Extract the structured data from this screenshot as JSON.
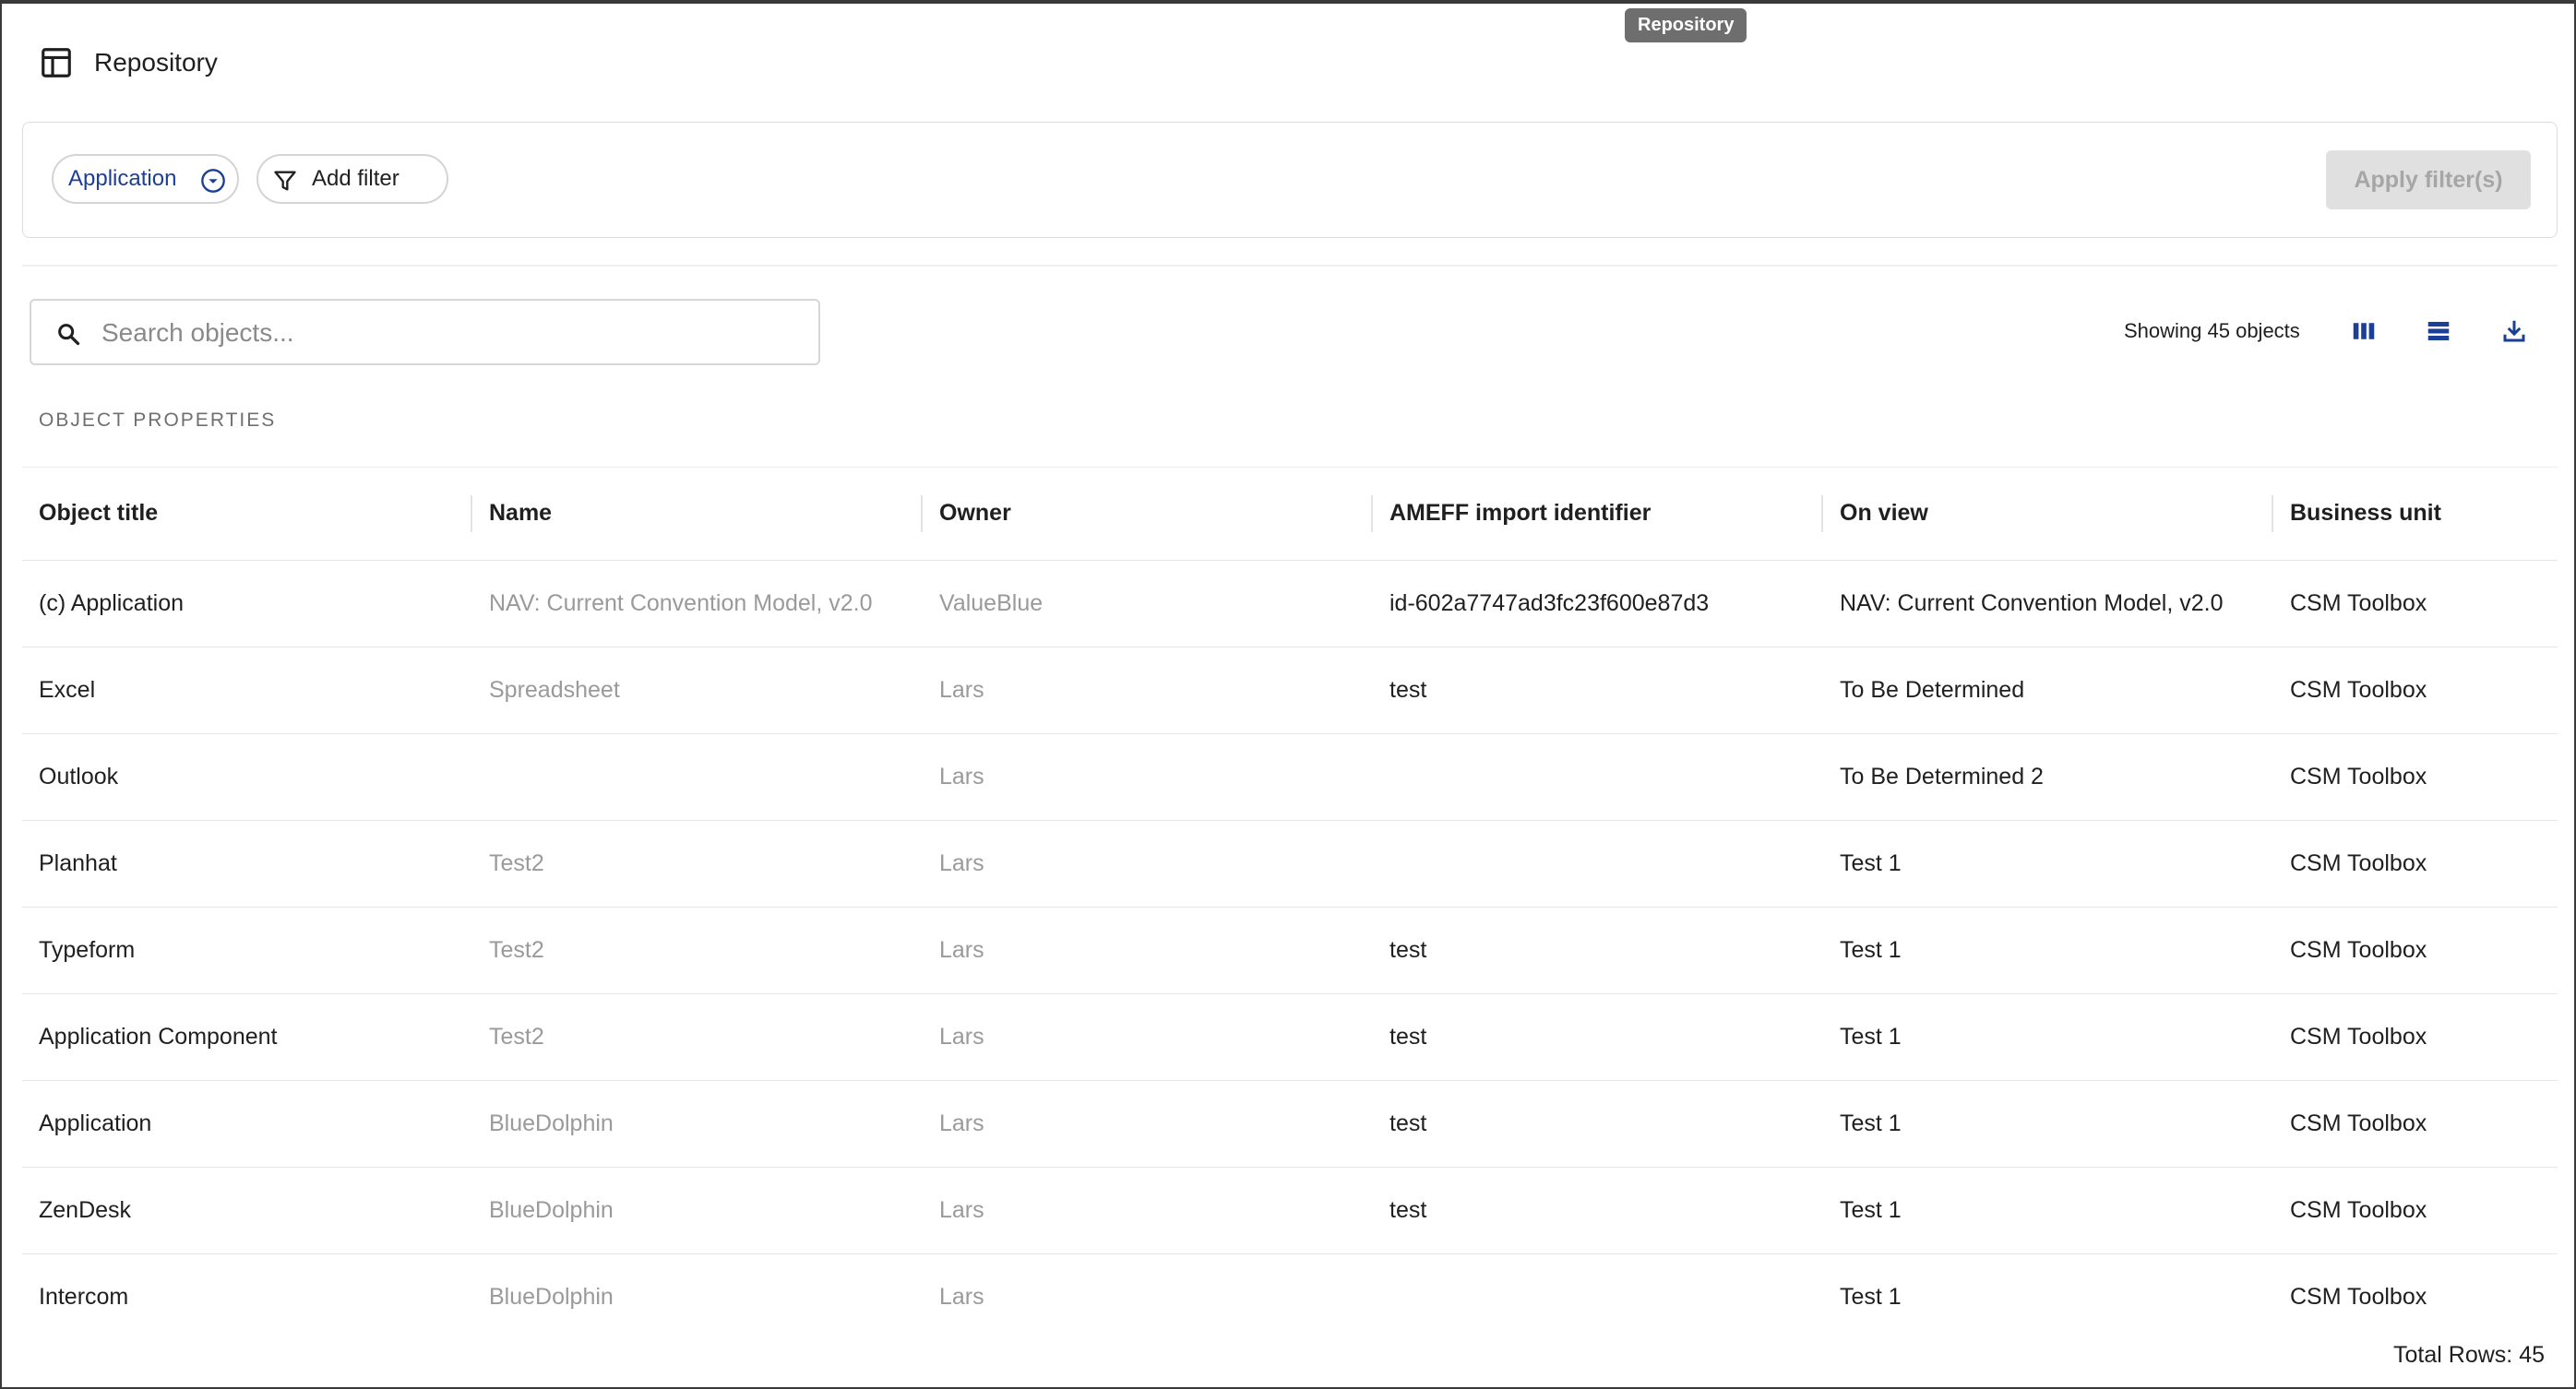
{
  "tooltip": "Repository",
  "header": {
    "title": "Repository",
    "icon": "table-icon"
  },
  "filters": {
    "chip_label": "Application",
    "add_filter_label": "Add filter",
    "apply_label": "Apply filter(s)"
  },
  "search": {
    "placeholder": "Search objects...",
    "value": ""
  },
  "toolbar": {
    "showing_text": "Showing 45 objects"
  },
  "section_label": "OBJECT PROPERTIES",
  "table": {
    "columns": [
      "Object title",
      "Name",
      "Owner",
      "AMEFF import identifier",
      "On view",
      "Business unit"
    ],
    "rows": [
      [
        "(c) Application",
        "NAV: Current Convention Model, v2.0",
        "ValueBlue",
        "id-602a7747ad3fc23f600e87d3",
        "NAV: Current Convention Model, v2.0",
        "CSM Toolbox"
      ],
      [
        "Excel",
        "Spreadsheet",
        "Lars",
        "test",
        "To Be Determined",
        "CSM Toolbox"
      ],
      [
        "Outlook",
        "",
        "Lars",
        "",
        "To Be Determined 2",
        "CSM Toolbox"
      ],
      [
        "Planhat",
        "Test2",
        "Lars",
        "",
        "Test 1",
        "CSM Toolbox"
      ],
      [
        "Typeform",
        "Test2",
        "Lars",
        "test",
        "Test 1",
        "CSM Toolbox"
      ],
      [
        "Application Component",
        "Test2",
        "Lars",
        "test",
        "Test 1",
        "CSM Toolbox"
      ],
      [
        "Application",
        "BlueDolphin",
        "Lars",
        "test",
        "Test 1",
        "CSM Toolbox"
      ],
      [
        "ZenDesk",
        "BlueDolphin",
        "Lars",
        "test",
        "Test 1",
        "CSM Toolbox"
      ],
      [
        "Intercom",
        "BlueDolphin",
        "Lars",
        "",
        "Test 1",
        "CSM Toolbox"
      ]
    ]
  },
  "footer": {
    "total_rows": "Total Rows: 45"
  },
  "colors": {
    "accent": "#1b3e97",
    "muted": "#9a9a9a",
    "apply_disabled_bg": "#e0e0e0"
  }
}
